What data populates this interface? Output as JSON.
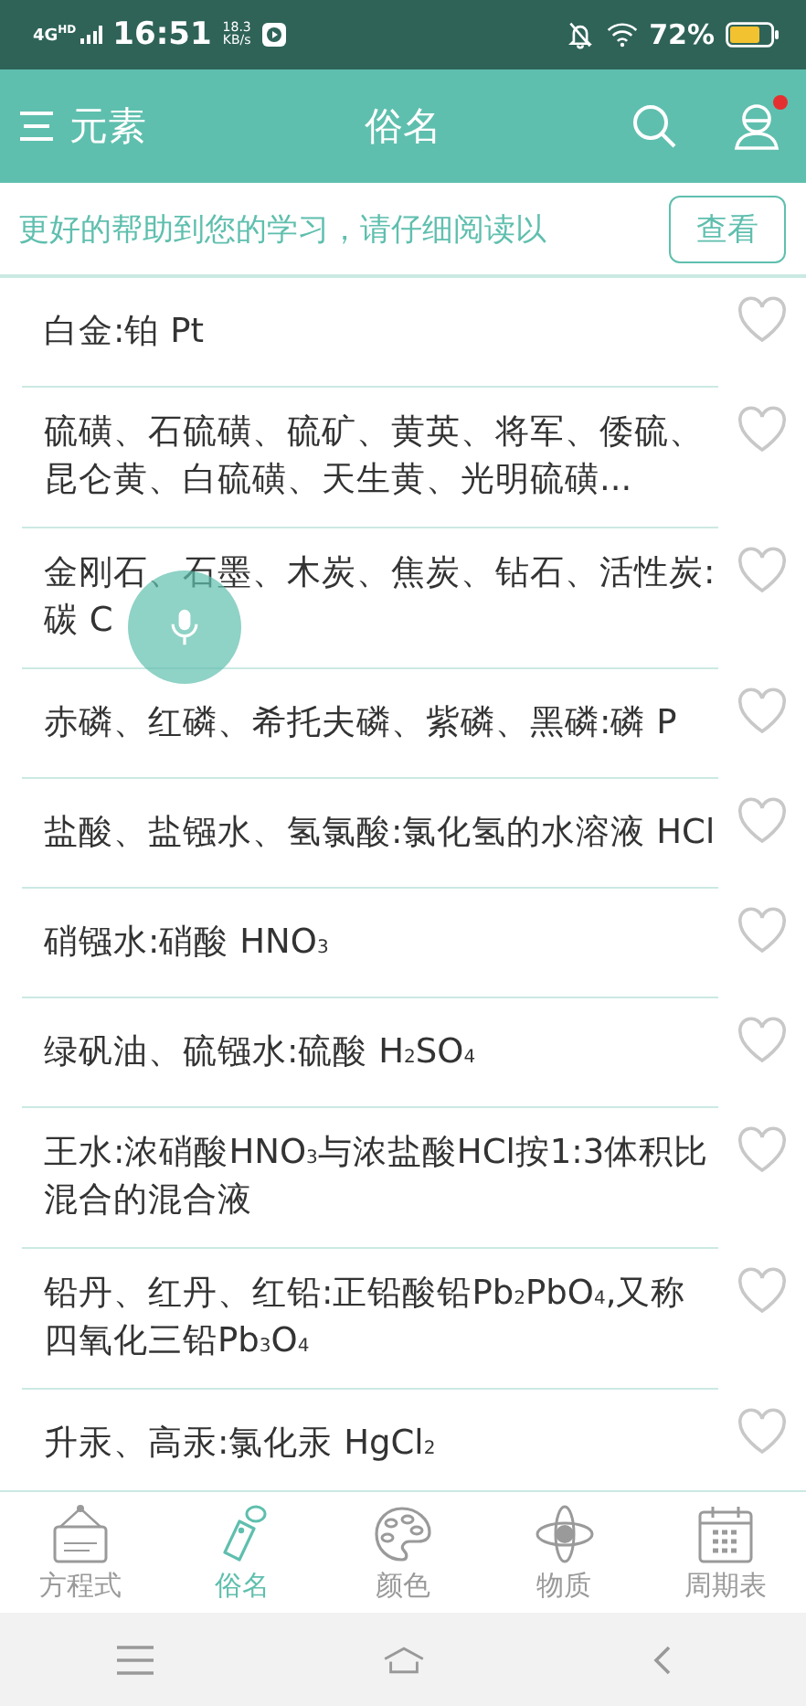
{
  "status_bar": {
    "network": "4G",
    "network_badge": "HD",
    "time": "16:51",
    "speed_value": "18.3",
    "speed_unit": "KB/s",
    "battery": "72%"
  },
  "header": {
    "menu_label": "元素",
    "title": "俗名",
    "has_notification": true
  },
  "banner": {
    "text": "更好的帮助到您的学习，请仔细阅读以",
    "button": "查看"
  },
  "items": [
    {
      "text": "白金:铂 Pt",
      "favorite": false
    },
    {
      "text": "硫磺、石硫磺、硫矿、黄英、将军、倭硫、昆仑黄、白硫磺、天生黄、光明硫磺...",
      "favorite": false
    },
    {
      "text": "金刚石、石墨、木炭、焦炭、钻石、活性炭:碳 C",
      "favorite": false
    },
    {
      "text": "赤磷、红磷、希托夫磷、紫磷、黑磷:磷 P",
      "favorite": false
    },
    {
      "text": "盐酸、盐镪水、氢氯酸:氯化氢的水溶液 HCl",
      "favorite": false
    },
    {
      "text": "硝镪水:硝酸 HNO$_{3}$",
      "favorite": false
    },
    {
      "text": "绿矾油、硫镪水:硫酸 H$_{2}$SO$_{4}$",
      "favorite": false
    },
    {
      "text": "王水:浓硝酸HNO$_{3}$与浓盐酸HCl按1:3体积比混合的混合液",
      "favorite": false
    },
    {
      "text": "铅丹、红丹、红铅:正铅酸铅Pb$_{2}$PbO$_{4}$,又称四氧化三铅Pb$_{3}$O$_{4}$",
      "favorite": false
    },
    {
      "text": "升汞、高汞:氯化汞 HgCl$_{2}$",
      "favorite": false
    }
  ],
  "tabs": [
    {
      "kind": "equation",
      "label": "方程式",
      "selected": false
    },
    {
      "kind": "tag",
      "label": "俗名",
      "selected": true
    },
    {
      "kind": "palette",
      "label": "颜色",
      "selected": false
    },
    {
      "kind": "atom",
      "label": "物质",
      "selected": false
    },
    {
      "kind": "calendar",
      "label": "周期表",
      "selected": false
    }
  ]
}
